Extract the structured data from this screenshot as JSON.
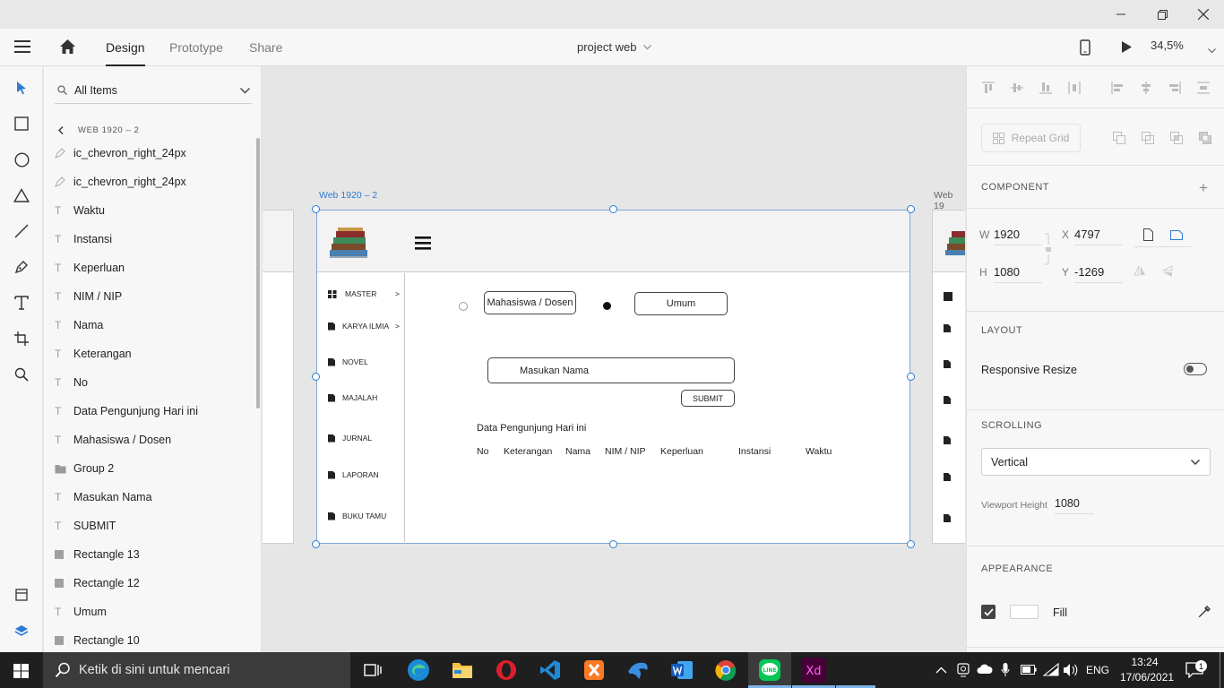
{
  "app": {
    "menu_tabs": [
      "Design",
      "Prototype",
      "Share"
    ],
    "doc_title": "project web",
    "zoom": "34,5%"
  },
  "layers": {
    "filter": "All Items",
    "back_label": "WEB 1920 – 2",
    "items": [
      {
        "type": "pen",
        "label": "ic_chevron_right_24px"
      },
      {
        "type": "pen",
        "label": "ic_chevron_right_24px"
      },
      {
        "type": "text",
        "label": "Waktu"
      },
      {
        "type": "text",
        "label": "Instansi"
      },
      {
        "type": "text",
        "label": "Keperluan"
      },
      {
        "type": "text",
        "label": "NIM / NIP"
      },
      {
        "type": "text",
        "label": "Nama"
      },
      {
        "type": "text",
        "label": "Keterangan"
      },
      {
        "type": "text",
        "label": "No"
      },
      {
        "type": "text",
        "label": "Data Pengunjung Hari ini"
      },
      {
        "type": "text",
        "label": "Mahasiswa /  Dosen"
      },
      {
        "type": "group",
        "label": "Group 2"
      },
      {
        "type": "text",
        "label": "Masukan Nama"
      },
      {
        "type": "text",
        "label": "SUBMIT"
      },
      {
        "type": "rect",
        "label": "Rectangle 13"
      },
      {
        "type": "rect",
        "label": "Rectangle 12"
      },
      {
        "type": "text",
        "label": "Umum"
      },
      {
        "type": "rect",
        "label": "Rectangle 10"
      }
    ]
  },
  "artboard": {
    "label": "Web 1920 – 2",
    "next_label": "Web 19",
    "sidebar": [
      {
        "label": "MASTER",
        "suffix": ">",
        "icon": "grid-icon"
      },
      {
        "label": "KARYA ILMIA",
        "suffix": ">",
        "icon": "document-icon"
      },
      {
        "label": "NOVEL",
        "suffix": "",
        "icon": "document-icon"
      },
      {
        "label": "MAJALAH",
        "suffix": "",
        "icon": "document-icon"
      },
      {
        "label": "JURNAL",
        "suffix": "",
        "icon": "document-icon"
      },
      {
        "label": "LAPORAN",
        "suffix": "",
        "icon": "document-icon"
      },
      {
        "label": "BUKU TAMU",
        "suffix": "",
        "icon": "document-icon"
      }
    ],
    "option_mahasiswa": "Mahasiswa /  Dosen",
    "option_umum": "Umum",
    "name_placeholder": "Masukan Nama",
    "submit": "SUBMIT",
    "table_title": "Data Pengunjung Hari ini",
    "columns": [
      "No",
      "Keterangan",
      "Nama",
      "NIM / NIP",
      "Keperluan",
      "Instansi",
      "Waktu"
    ]
  },
  "props": {
    "repeat_grid": "Repeat Grid",
    "component": "COMPONENT",
    "w_label": "W",
    "w": "1920",
    "h_label": "H",
    "h": "1080",
    "x_label": "X",
    "x": "4797",
    "y_label": "Y",
    "y": "-1269",
    "layout": "LAYOUT",
    "responsive_resize": "Responsive Resize",
    "responsive_on": false,
    "scrolling": "SCROLLING",
    "scroll_value": "Vertical",
    "viewport_label": "Viewport Height",
    "viewport_value": "1080",
    "appearance": "APPEARANCE",
    "fill_label": "Fill",
    "fill_checked": true,
    "fill_color": "#ffffff"
  },
  "taskbar": {
    "search_placeholder": "Ketik di sini untuk mencari",
    "lang": "ENG",
    "time": "13:24",
    "date": "17/06/2021",
    "notifications": "1"
  },
  "colors": {
    "accent": "#2e7bd6",
    "xd_purple": "#470137",
    "xd_pink": "#ff61f6"
  }
}
